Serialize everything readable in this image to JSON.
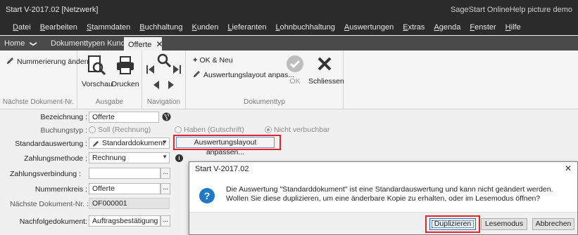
{
  "window": {
    "title": "Start V-2017.02 [Netzwerk]",
    "brand": "SageStart OnlineHelp picture demo"
  },
  "menu": [
    {
      "u": "D",
      "rest": "atei"
    },
    {
      "u": "B",
      "rest": "earbeiten"
    },
    {
      "u": "S",
      "rest": "tammdaten"
    },
    {
      "u": "B",
      "rest": "uchhaltung"
    },
    {
      "u": "K",
      "rest": "unden"
    },
    {
      "u": "L",
      "rest": "ieferanten"
    },
    {
      "u": "L",
      "rest": "ohnbuchhaltung"
    },
    {
      "u": "A",
      "rest": "uswertungen"
    },
    {
      "u": "E",
      "rest": "xtras"
    },
    {
      "u": "A",
      "rest": "genda"
    },
    {
      "u": "F",
      "rest": "enster"
    },
    {
      "u": "H",
      "rest": "ilfe"
    }
  ],
  "tabs": {
    "home": "Home",
    "dokumenttypen": "Dokumenttypen Kunden",
    "offerte": "Offerte",
    "close_glyph": "✕",
    "chevron_glyph": "❯"
  },
  "ribbon": {
    "nummerierung": "Nummerierung ändern",
    "group_naechste": "Nächste Dokument-Nr.",
    "vorschau": "Vorschau",
    "drucken": "Drucken",
    "group_ausgabe": "Ausgabe",
    "group_navigation": "Navigation",
    "ok_neu": "OK & Neu",
    "auswertungslayout": "Auswertungslayout anpas...",
    "ok": "OK",
    "schliessen": "Schliessen",
    "group_dokumenttyp": "Dokumenttyp"
  },
  "form": {
    "bezeichnung_label": "Bezeichnung :",
    "bezeichnung_value": "Offerte",
    "buchungstyp_label": "Buchungstyp :",
    "radio_soll": "Soll (Rechnung)",
    "radio_haben": "Haben (Gutschrift)",
    "radio_nicht": "Nicht verbuchbar",
    "standardauswertung_label": "Standardauswertung :",
    "standardauswertung_value": "Standarddokument",
    "auswertungslayout_button": "Auswertungslayout anpassen...",
    "zahlungsmethode_label": "Zahlungsmethode :",
    "zahlungsmethode_value": "Rechnung",
    "zahlungsverbindung_label": "Zahlungsverbindung :",
    "zahlungsverbindung_value": "",
    "nummernkreis_label": "Nummernkreis :",
    "nummernkreis_value": "Offerte",
    "naechste_label": "Nächste Dokument-Nr. :",
    "naechste_value": "OF000001",
    "nachfolge_label": "Nachfolgedokument:",
    "nachfolge_value": "Auftragsbestätigung",
    "dots": "...",
    "dropdown_arrow": "▼",
    "info_glyph": "i"
  },
  "dialog": {
    "title": "Start V-2017.02",
    "close_glyph": "✕",
    "icon_glyph": "?",
    "message": "Die Auswertung \"Standarddokument\" ist eine Standardauswertung und kann nicht geändert werden. Wollen Sie diese duplizieren, um eine änderbare Kopie zu erhalten, oder im Lesemodus öffnen?",
    "btn_duplizieren": "Duplizieren",
    "btn_lesemodus": "Lesemodus",
    "btn_abbrechen": "Abbrechen"
  },
  "colors": {
    "titlebar": "#2b2b2b",
    "tabstrip": "#4a4a4a",
    "highlight_red": "#e0262b",
    "dialog_icon_blue": "#1e79c6"
  }
}
